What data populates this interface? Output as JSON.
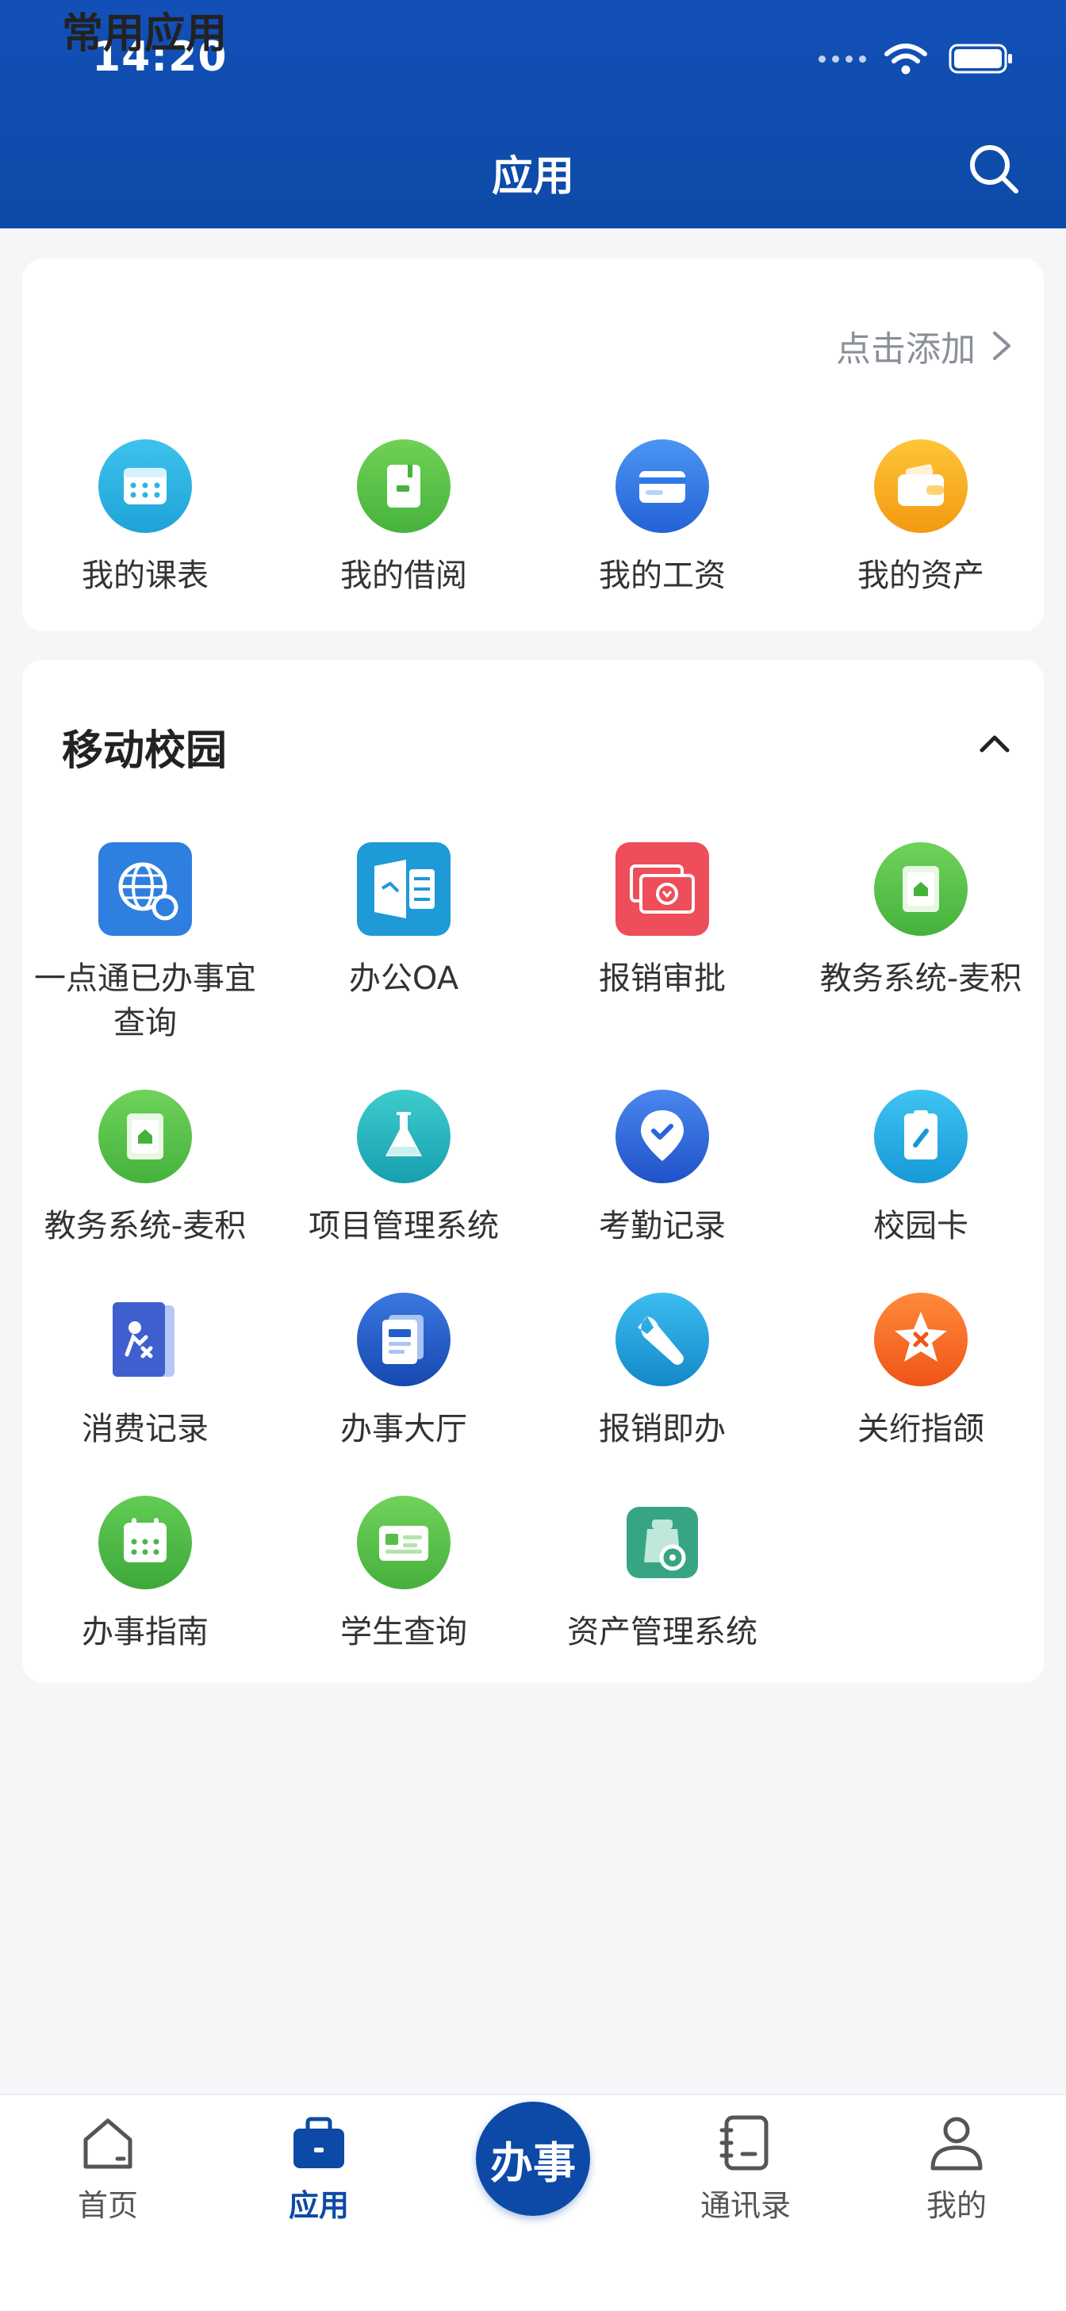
{
  "status_bar": {
    "time": "14:20"
  },
  "header": {
    "title": "应用"
  },
  "common_apps": {
    "title": "常用应用",
    "add_label": "点击添加",
    "items": [
      {
        "label": "我的课表",
        "icon": "calendar-icon",
        "color": "#2bb5e0"
      },
      {
        "label": "我的借阅",
        "icon": "book-icon",
        "color": "#5cc24a"
      },
      {
        "label": "我的工资",
        "icon": "card-icon",
        "color": "#2c78e8"
      },
      {
        "label": "我的资产",
        "icon": "wallet-icon",
        "color": "#f6ad1c"
      }
    ]
  },
  "campus_apps": {
    "title": "移动校园",
    "items": [
      {
        "label": "一点通已办事宜查询",
        "icon": "globe-search-icon",
        "color": "#2f7fe0"
      },
      {
        "label": "办公OA",
        "icon": "oa-icon",
        "color": "#1e9ad6"
      },
      {
        "label": "报销审批",
        "icon": "money-icon",
        "color": "#ee4d5a"
      },
      {
        "label": "教务系统-麦积",
        "icon": "edu-icon",
        "color": "#54c04a"
      },
      {
        "label": "教务系统-麦积",
        "icon": "edu-icon",
        "color": "#54c04a"
      },
      {
        "label": "项目管理系统",
        "icon": "flask-icon",
        "color": "#1fb6b8"
      },
      {
        "label": "考勤记录",
        "icon": "location-check-icon",
        "color": "#2c64d8"
      },
      {
        "label": "校园卡",
        "icon": "campus-card-icon",
        "color": "#25aee8"
      },
      {
        "label": "消费记录",
        "icon": "consume-record-icon",
        "color": "#3f5fcf"
      },
      {
        "label": "办事大厅",
        "icon": "hall-icon",
        "color": "#2160c8"
      },
      {
        "label": "报销即办",
        "icon": "wrench-icon",
        "color": "#1ea4dc"
      },
      {
        "label": "关绗指颌",
        "icon": "star-icon",
        "color": "#f26a25"
      },
      {
        "label": "办事指南",
        "icon": "guide-calendar-icon",
        "color": "#48b84a"
      },
      {
        "label": "学生查询",
        "icon": "student-card-icon",
        "color": "#55c048"
      },
      {
        "label": "资产管理系统",
        "icon": "asset-bag-icon",
        "color": "#37a583"
      }
    ]
  },
  "bottom_nav": {
    "items": [
      {
        "label": "首页",
        "icon": "home-icon"
      },
      {
        "label": "应用",
        "icon": "briefcase-icon",
        "active": true
      },
      {
        "label": "通讯录",
        "icon": "contacts-icon"
      },
      {
        "label": "我的",
        "icon": "user-icon"
      }
    ],
    "center_label": "办事"
  },
  "theme": {
    "primary": "#0d4aa7",
    "background": "#f5f6f8"
  }
}
